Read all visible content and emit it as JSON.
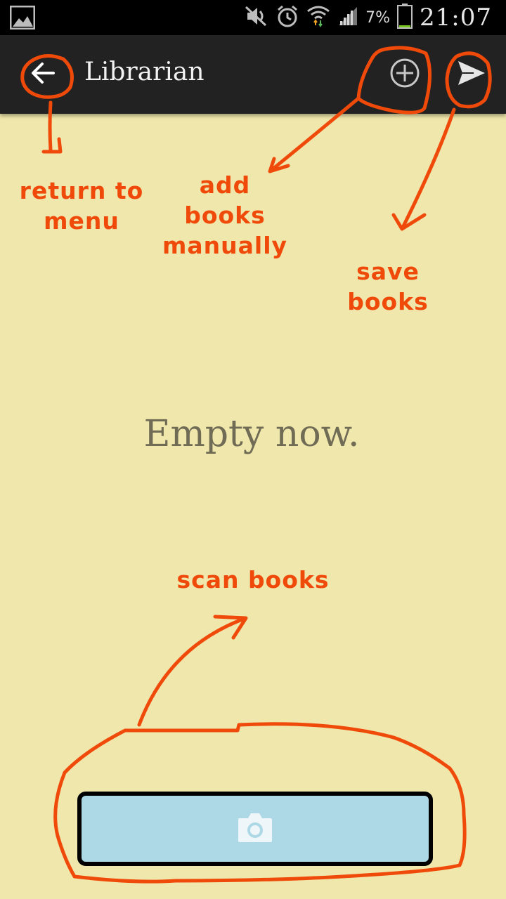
{
  "status_bar": {
    "battery_percent": "7%",
    "time": "21:07"
  },
  "action_bar": {
    "title": "Librarian"
  },
  "main": {
    "empty_message": "Empty now."
  },
  "annotations": {
    "return_line1": "return to",
    "return_line2": "menu",
    "add_line1": "add",
    "add_line2": "books",
    "add_line3": "manually",
    "save_line1": "save",
    "save_line2": "books",
    "scan": "scan books"
  },
  "icons": {
    "back": "arrow-left-icon",
    "add": "plus-circle-icon",
    "send": "send-icon",
    "camera": "camera-icon"
  },
  "colors": {
    "background": "#efe7ab",
    "action_bar": "#222222",
    "scan_button": "#add8e6",
    "annotation": "#f04a0a"
  }
}
